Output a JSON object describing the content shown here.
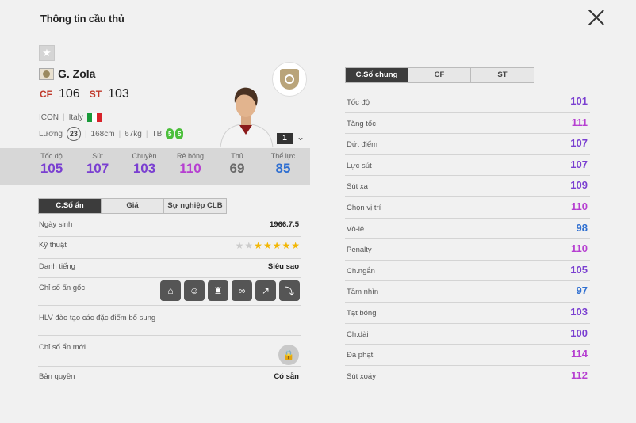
{
  "header": {
    "title": "Thông tin cầu thủ"
  },
  "player": {
    "name": "G. Zola",
    "positions": [
      {
        "pos": "CF",
        "ovr": "106"
      },
      {
        "pos": "ST",
        "ovr": "103"
      }
    ],
    "season": "ICON",
    "nation": "Italy",
    "salary_label": "Lương",
    "salary": "23",
    "height": "168cm",
    "weight": "67kg",
    "body": "TB",
    "weak_foot": "5",
    "strong_foot": "5",
    "level": "1"
  },
  "summary_stats": [
    {
      "label": "Tốc độ",
      "value": "105",
      "color": "#7a3fd1"
    },
    {
      "label": "Sút",
      "value": "107",
      "color": "#7a3fd1"
    },
    {
      "label": "Chuyền",
      "value": "103",
      "color": "#7a3fd1"
    },
    {
      "label": "Rê bóng",
      "value": "110",
      "color": "#b63fd1"
    },
    {
      "label": "Thủ",
      "value": "69",
      "color": "#6a6a6a"
    },
    {
      "label": "Thể lực",
      "value": "85",
      "color": "#2f6fd1"
    }
  ],
  "left_tabs": [
    "C.Số ẩn",
    "Giá",
    "Sự nghiệp CLB"
  ],
  "info": {
    "dob_label": "Ngày sinh",
    "dob": "1966.7.5",
    "skill_label": "Kỹ thuật",
    "skill_stars": 5,
    "skill_max": 7,
    "rep_label": "Danh tiếng",
    "rep": "Siêu sao",
    "hidden_label": "Chỉ số ẩn gốc",
    "coach_label": "HLV đào tạo các đặc điểm bổ sung",
    "new_hidden_label": "Chỉ số ẩn mới",
    "rights_label": "Bản quyền",
    "rights": "Có sẵn"
  },
  "trait_icons": [
    "goal-net-icon",
    "head-icon",
    "trophy-ball-icon",
    "dribble-icon",
    "cross-icon",
    "curve-icon"
  ],
  "right_tabs": [
    "C.Số chung",
    "CF",
    "ST"
  ],
  "attributes": [
    {
      "label": "Tốc độ",
      "value": "101",
      "color": "#7a3fd1"
    },
    {
      "label": "Tăng tốc",
      "value": "111",
      "color": "#b63fd1"
    },
    {
      "label": "Dứt điểm",
      "value": "107",
      "color": "#7a3fd1"
    },
    {
      "label": "Lực sút",
      "value": "107",
      "color": "#7a3fd1"
    },
    {
      "label": "Sút xa",
      "value": "109",
      "color": "#7a3fd1"
    },
    {
      "label": "Chọn vị trí",
      "value": "110",
      "color": "#b63fd1"
    },
    {
      "label": "Vô-lê",
      "value": "98",
      "color": "#2f6fd1"
    },
    {
      "label": "Penalty",
      "value": "110",
      "color": "#b63fd1"
    },
    {
      "label": "Ch.ngắn",
      "value": "105",
      "color": "#7a3fd1"
    },
    {
      "label": "Tầm nhìn",
      "value": "97",
      "color": "#2f6fd1"
    },
    {
      "label": "Tạt bóng",
      "value": "103",
      "color": "#7a3fd1"
    },
    {
      "label": "Ch.dài",
      "value": "100",
      "color": "#7a3fd1"
    },
    {
      "label": "Đá phạt",
      "value": "114",
      "color": "#b63fd1"
    },
    {
      "label": "Sút xoáy",
      "value": "112",
      "color": "#b63fd1"
    }
  ]
}
